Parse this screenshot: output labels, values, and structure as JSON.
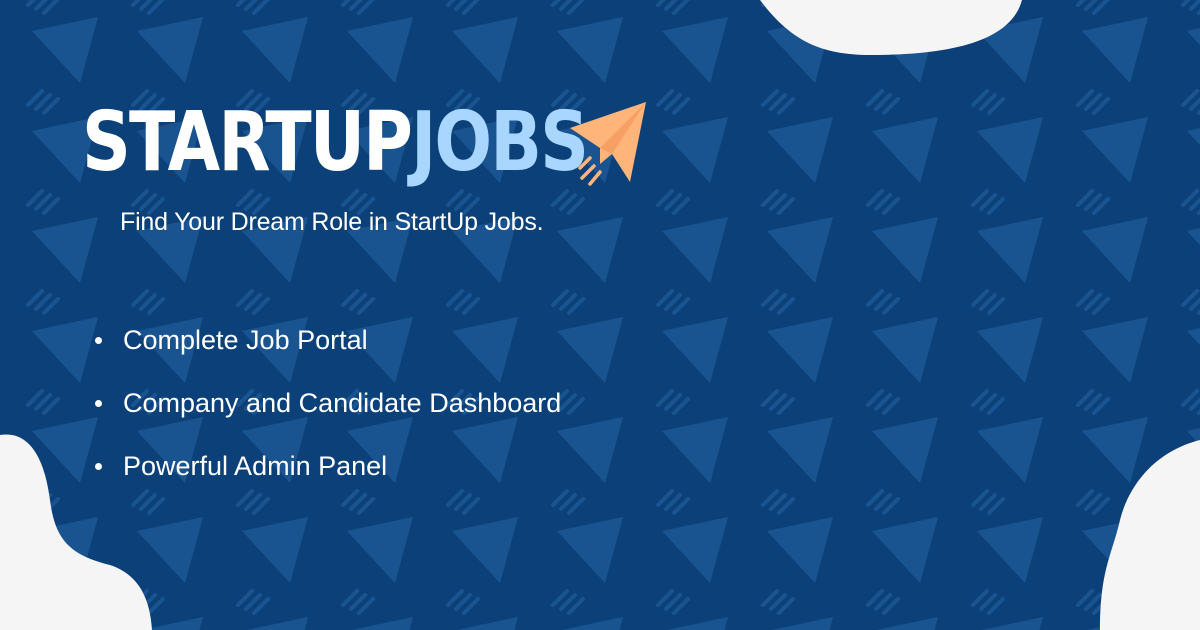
{
  "brand": {
    "name_part1": "STARTUP",
    "name_part2": "JOBS",
    "icon": "rocket-paper-plane-icon",
    "colors": {
      "background": "#0b4178",
      "pattern": "#1a5490",
      "accent_blue": "#a9d6ff",
      "rocket": "#ffb47a",
      "blob": "#f5f5f6"
    }
  },
  "tagline": "Find Your Dream Role in StartUp Jobs.",
  "features": [
    "Complete Job Portal",
    "Company and Candidate Dashboard",
    "Powerful Admin Panel"
  ]
}
